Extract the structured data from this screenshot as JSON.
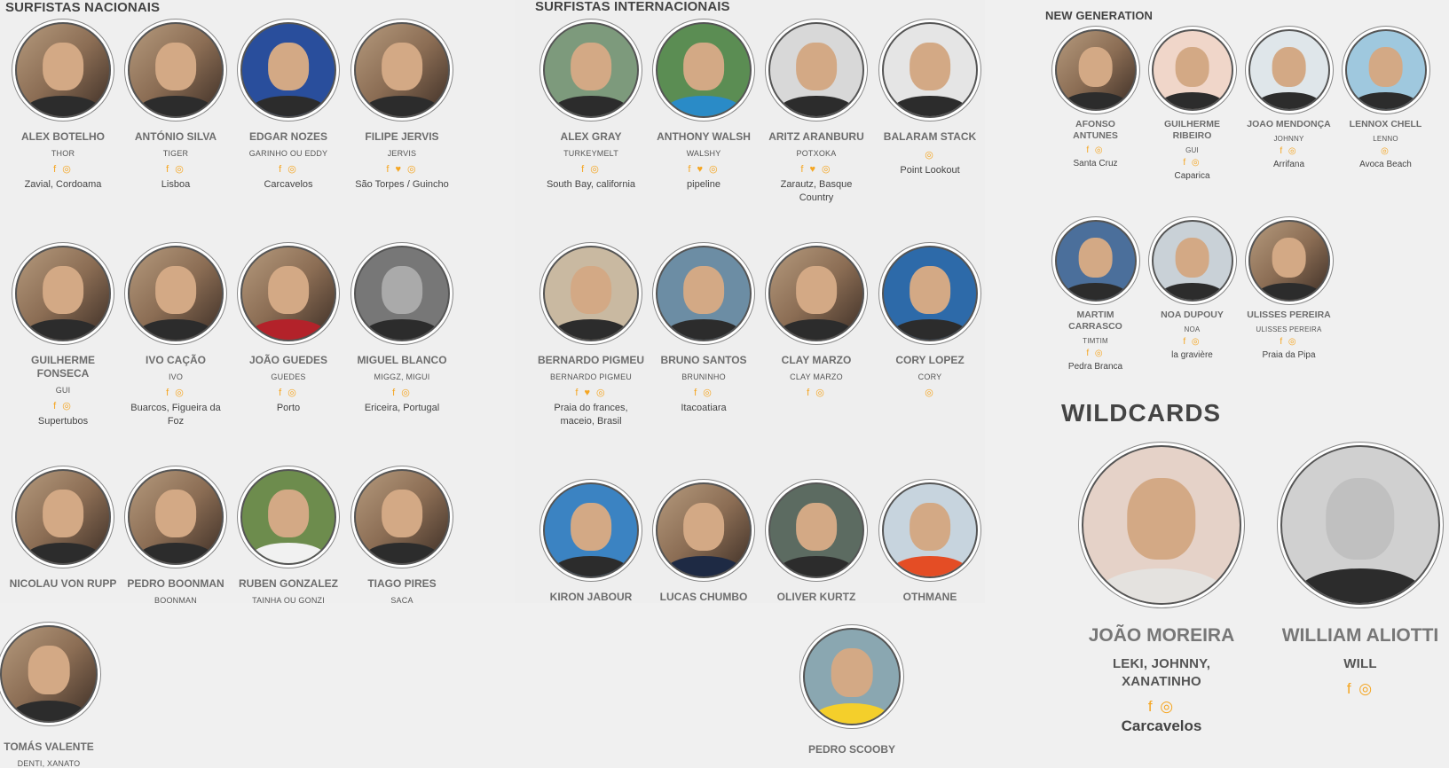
{
  "sections": {
    "nacionais": "SURFISTAS NACIONAIS",
    "internacionais": "SURFISTAS INTERNACIONAIS",
    "new_generation": "NEW GENERATION",
    "wildcards": "WILDCARDS"
  },
  "nacionais": [
    {
      "name": "ALEX BOTELHO",
      "nick": "THOR",
      "social": "f ◎",
      "loc": "Zavial, Cordoama"
    },
    {
      "name": "ANTÓNIO SILVA",
      "nick": "TIGER",
      "social": "f ◎",
      "loc": "Lisboa"
    },
    {
      "name": "EDGAR NOZES",
      "nick": "GARINHO OU EDDY",
      "social": "f ◎",
      "loc": "Carcavelos"
    },
    {
      "name": "FILIPE JERVIS",
      "nick": "JERVIS",
      "social": "f ♥ ◎",
      "loc": "São Torpes / Guincho"
    },
    {
      "name": "GUILHERME FONSECA",
      "nick": "GUI",
      "social": "f ◎",
      "loc": "Supertubos"
    },
    {
      "name": "IVO CAÇÃO",
      "nick": "IVO",
      "social": "f ◎",
      "loc": "Buarcos, Figueira da Foz"
    },
    {
      "name": "JOÃO GUEDES",
      "nick": "GUEDES",
      "social": "f ◎",
      "loc": "Porto"
    },
    {
      "name": "MIGUEL BLANCO",
      "nick": "MIGGZ, MIGUI",
      "social": "f ◎",
      "loc": "Ericeira, Portugal"
    },
    {
      "name": "NICOLAU VON RUPP",
      "nick": "",
      "social": "",
      "loc": ""
    },
    {
      "name": "PEDRO BOONMAN",
      "nick": "BOONMAN",
      "social": "",
      "loc": ""
    },
    {
      "name": "RUBEN GONZALEZ",
      "nick": "TAINHA OU GONZI",
      "social": "",
      "loc": ""
    },
    {
      "name": "TIAGO PIRES",
      "nick": "SACA",
      "social": "",
      "loc": ""
    },
    {
      "name": "TOMÁS VALENTE",
      "nick": "DENTI, XANATO",
      "social": "",
      "loc": ""
    }
  ],
  "internacionais": [
    {
      "name": "ALEX GRAY",
      "nick": "TURKEYMELT",
      "social": "f ◎",
      "loc": "South Bay, california"
    },
    {
      "name": "ANTHONY WALSH",
      "nick": "WALSHY",
      "social": "f ♥ ◎",
      "loc": "pipeline"
    },
    {
      "name": "ARITZ ARANBURU",
      "nick": "POTXOKA",
      "social": "f ♥ ◎",
      "loc": "Zarautz, Basque Country"
    },
    {
      "name": "BALARAM STACK",
      "nick": "",
      "social": "◎",
      "loc": "Point Lookout"
    },
    {
      "name": "BERNARDO PIGMEU",
      "nick": "BERNARDO PIGMEU",
      "social": "f ♥ ◎",
      "loc": "Praia do frances, maceio, Brasil"
    },
    {
      "name": "BRUNO SANTOS",
      "nick": "BRUNINHO",
      "social": "f ◎",
      "loc": "Itacoatiara"
    },
    {
      "name": "CLAY MARZO",
      "nick": "CLAY MARZO",
      "social": "f ◎",
      "loc": ""
    },
    {
      "name": "CORY LOPEZ",
      "nick": "CORY",
      "social": "◎",
      "loc": ""
    },
    {
      "name": "KIRON JABOUR",
      "nick": "",
      "social": "",
      "loc": ""
    },
    {
      "name": "LUCAS CHUMBO",
      "nick": "",
      "social": "",
      "loc": ""
    },
    {
      "name": "OLIVER KURTZ",
      "nick": "",
      "social": "",
      "loc": ""
    },
    {
      "name": "OTHMANE",
      "nick": "",
      "social": "",
      "loc": ""
    },
    {
      "name": "PEDRO SCOOBY",
      "nick": "",
      "social": "",
      "loc": ""
    }
  ],
  "new_generation": [
    {
      "name": "AFONSO ANTUNES",
      "nick": "",
      "social": "f ◎",
      "loc": "Santa Cruz"
    },
    {
      "name": "GUILHERME RIBEIRO",
      "nick": "GUI",
      "social": "f ◎",
      "loc": "Caparica"
    },
    {
      "name": "JOAO MENDONÇA",
      "nick": "JOHNNY",
      "social": "f ◎",
      "loc": "Arrifana"
    },
    {
      "name": "LENNOX CHELL",
      "nick": "LENNO",
      "social": "◎",
      "loc": "Avoca Beach"
    },
    {
      "name": "MARTIM CARRASCO",
      "nick": "TIMTIM",
      "social": "f ◎",
      "loc": "Pedra Branca"
    },
    {
      "name": "NOA DUPOUY",
      "nick": "NOA",
      "social": "f ◎",
      "loc": "la gravière"
    },
    {
      "name": "ULISSES PEREIRA",
      "nick": "ULISSES PEREIRA",
      "social": "f ◎",
      "loc": "Praia da Pipa"
    }
  ],
  "wildcards": [
    {
      "name": "JOÃO MOREIRA",
      "nick": "LEKI, JOHNNY, XANATINHO",
      "social": "f ◎",
      "loc": "Carcavelos"
    },
    {
      "name": "WILLIAM ALIOTTI",
      "nick": "WILL",
      "social": "f ◎",
      "loc": ""
    }
  ]
}
